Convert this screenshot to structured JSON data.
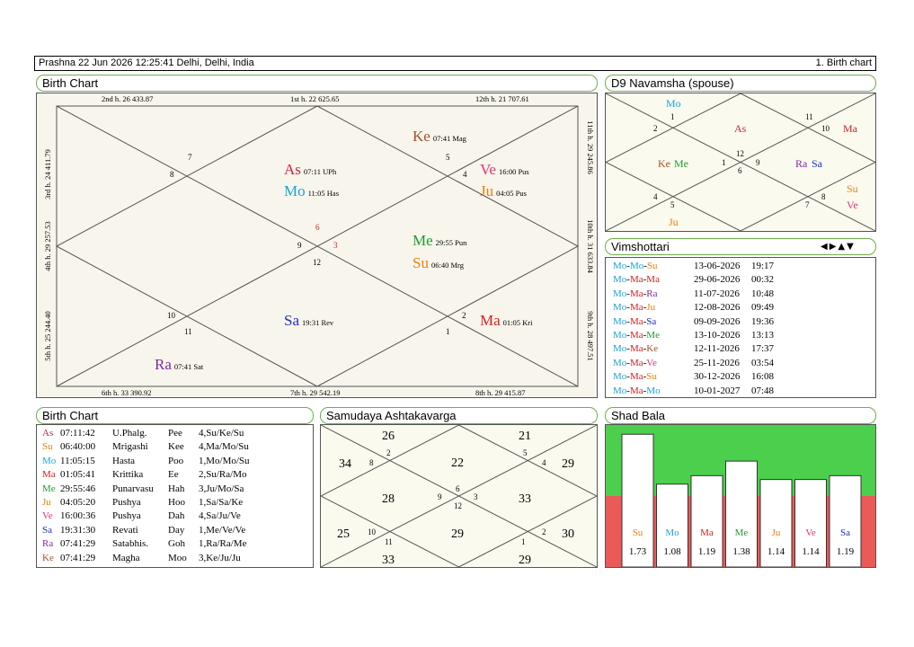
{
  "header": {
    "title": "Prashna   22 Jun 2026 12:25:41  Delhi, Delhi, India",
    "right": "1. Birth chart"
  },
  "colors": {
    "As": "#d6204a",
    "Mo": "#1aa3d6",
    "Ke": "#a0522d",
    "Ve": "#e8307a",
    "Ju": "#e8820c",
    "Me": "#1e9b2e",
    "Su": "#e8820c",
    "Sa": "#1c2fc2",
    "Ma": "#d6201e",
    "Ra": "#7d2a9e"
  },
  "birth_chart": {
    "title": "Birth Chart",
    "house_labels": {
      "h1": "1st h.  22  625.65",
      "h2": "2nd h.  26  433.87",
      "h3": "3rd h.  24  411.79",
      "h4": "4th h.  29  257.53",
      "h5": "5th h.  25  244.40",
      "h6": "6th h.  33  390.92",
      "h7": "7th h.  29  542.19",
      "h8": "8th h.  29  415.87",
      "h9": "9th h.  28  497.51",
      "h10": "10th h.  31  633.84",
      "h11": "11th h.  29  245.86",
      "h12": "12th h.  21  707.61"
    },
    "signs": {
      "s7": "7",
      "s8": "8",
      "s6": "6",
      "s9": "9",
      "s3": "3",
      "s12": "12",
      "s5": "5",
      "s4": "4",
      "s10": "10",
      "s11": "11",
      "s2": "2",
      "s1": "1"
    },
    "planets": {
      "As": {
        "abbr": "As",
        "detail": "07:11  UPh"
      },
      "Mo": {
        "abbr": "Mo",
        "detail": "11:05  Has"
      },
      "Ke": {
        "abbr": "Ke",
        "detail": "07:41  Mag"
      },
      "Ve": {
        "abbr": "Ve",
        "detail": "16:00  Pus"
      },
      "Ju": {
        "abbr": "Ju",
        "detail": "04:05  Pus"
      },
      "Me": {
        "abbr": "Me",
        "detail": "29:55  Pun"
      },
      "Su": {
        "abbr": "Su",
        "detail": "06:40  Mrg"
      },
      "Sa": {
        "abbr": "Sa",
        "detail": "19:31  Rev"
      },
      "Ma": {
        "abbr": "Ma",
        "detail": "01:05  Kri"
      },
      "Ra": {
        "abbr": "Ra",
        "detail": "07:41  Sat"
      }
    }
  },
  "navamsha": {
    "title": "D9 Navamsha  (spouse)",
    "signs": {
      "n1": "1",
      "n2": "2",
      "n11": "11",
      "n10": "10",
      "n12": "12",
      "n9": "9",
      "n6": "6",
      "n4": "4",
      "n5": "5",
      "n7": "7",
      "n8": "8"
    },
    "planets": {
      "Mo": "Mo",
      "As": "As",
      "Ma": "Ma",
      "Ke": "Ke",
      "Me": "Me",
      "Ra": "Ra",
      "Sa": "Sa",
      "Su": "Su",
      "Ve": "Ve",
      "Ju": "Ju"
    }
  },
  "vimshottari": {
    "title": "Vimshottari",
    "nav_icons": [
      "prev-icon",
      "next-icon",
      "up-icon",
      "down-icon"
    ],
    "nav_glyphs": "◀▶▲▼",
    "rows": [
      {
        "p1": "Mo",
        "p2": "Mo",
        "p3": "Su",
        "date": "13-06-2026",
        "time": "19:17"
      },
      {
        "p1": "Mo",
        "p2": "Ma",
        "p3": "Ma",
        "date": "29-06-2026",
        "time": "00:32"
      },
      {
        "p1": "Mo",
        "p2": "Ma",
        "p3": "Ra",
        "date": "11-07-2026",
        "time": "10:48"
      },
      {
        "p1": "Mo",
        "p2": "Ma",
        "p3": "Ju",
        "date": "12-08-2026",
        "time": "09:49"
      },
      {
        "p1": "Mo",
        "p2": "Ma",
        "p3": "Sa",
        "date": "09-09-2026",
        "time": "19:36"
      },
      {
        "p1": "Mo",
        "p2": "Ma",
        "p3": "Me",
        "date": "13-10-2026",
        "time": "13:13"
      },
      {
        "p1": "Mo",
        "p2": "Ma",
        "p3": "Ke",
        "date": "12-11-2026",
        "time": "17:37"
      },
      {
        "p1": "Mo",
        "p2": "Ma",
        "p3": "Ve",
        "date": "25-11-2026",
        "time": "03:54"
      },
      {
        "p1": "Mo",
        "p2": "Ma",
        "p3": "Su",
        "date": "30-12-2026",
        "time": "16:08"
      },
      {
        "p1": "Mo",
        "p2": "Ma",
        "p3": "Mo",
        "date": "10-01-2027",
        "time": "07:48"
      }
    ]
  },
  "planet_list": {
    "title": "Birth Chart",
    "rows": [
      {
        "p": "As",
        "deg": "07:11:42",
        "nak": "U.Phalg.",
        "syl": "Pee",
        "pada": "4,Su/Ke/Su"
      },
      {
        "p": "Su",
        "deg": "06:40:00",
        "nak": "Mrigashi",
        "syl": "Kee",
        "pada": "4,Ma/Mo/Su"
      },
      {
        "p": "Mo",
        "deg": "11:05:15",
        "nak": "Hasta",
        "syl": "Poo",
        "pada": "1,Mo/Mo/Su"
      },
      {
        "p": "Ma",
        "deg": "01:05:41",
        "nak": "Krittika",
        "syl": "Ee",
        "pada": "2,Su/Ra/Mo"
      },
      {
        "p": "Me",
        "deg": "29:55:46",
        "nak": "Punarvasu",
        "syl": "Hah",
        "pada": "3,Ju/Mo/Sa"
      },
      {
        "p": "Ju",
        "deg": "04:05:20",
        "nak": "Pushya",
        "syl": "Hoo",
        "pada": "1,Sa/Sa/Ke"
      },
      {
        "p": "Ve",
        "deg": "16:00:36",
        "nak": "Pushya",
        "syl": "Dah",
        "pada": "4,Sa/Ju/Ve"
      },
      {
        "p": "Sa",
        "deg": "19:31:30",
        "nak": "Revati",
        "syl": "Day",
        "pada": "1,Me/Ve/Ve"
      },
      {
        "p": "Ra",
        "deg": "07:41:29",
        "nak": "Satabhis.",
        "syl": "Goh",
        "pada": "1,Ra/Ra/Me"
      },
      {
        "p": "Ke",
        "deg": "07:41:29",
        "nak": "Magha",
        "syl": "Moo",
        "pada": "3,Ke/Ju/Ju"
      }
    ]
  },
  "ashtakavarga": {
    "title": "Samudaya Ashtakavarga",
    "values": {
      "h1": "22",
      "h2": "26",
      "h3": "34",
      "h4": "28",
      "h5": "25",
      "h6": "33",
      "h7": "29",
      "h8": "29",
      "h9": "30",
      "h10": "33",
      "h11": "29",
      "h12": "21"
    },
    "signs": {
      "s2": "2",
      "s8": "8",
      "s5": "5",
      "s4": "4",
      "s6": "6",
      "s9": "9",
      "s3": "3",
      "s12": "12",
      "s10": "10",
      "s11": "11",
      "s1": "1",
      "s2b": "2"
    }
  },
  "shad_bala": {
    "title": "Shad Bala",
    "bars": [
      {
        "p": "Su",
        "v": 1.73,
        "label": "1.73"
      },
      {
        "p": "Mo",
        "v": 1.08,
        "label": "1.08"
      },
      {
        "p": "Ma",
        "v": 1.19,
        "label": "1.19"
      },
      {
        "p": "Me",
        "v": 1.38,
        "label": "1.38"
      },
      {
        "p": "Ju",
        "v": 1.14,
        "label": "1.14"
      },
      {
        "p": "Ve",
        "v": 1.14,
        "label": "1.14"
      },
      {
        "p": "Sa",
        "v": 1.19,
        "label": "1.19"
      }
    ],
    "colors": {
      "green": "#4ccf4c",
      "red": "#ec5a57"
    }
  }
}
